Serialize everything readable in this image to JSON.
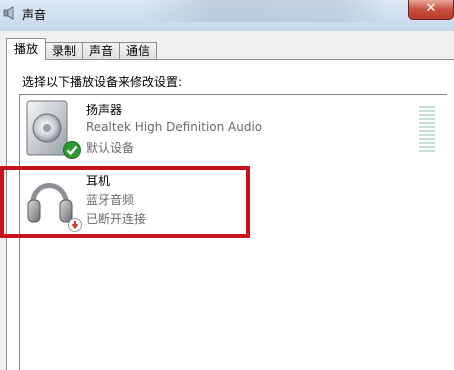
{
  "window": {
    "title": "声音",
    "close_label": "✕"
  },
  "tabs": [
    {
      "label": "播放",
      "active": true
    },
    {
      "label": "录制",
      "active": false
    },
    {
      "label": "声音",
      "active": false
    },
    {
      "label": "通信",
      "active": false
    }
  ],
  "main": {
    "instruction": "选择以下播放设备来修改设置:"
  },
  "devices": [
    {
      "name": "扬声器",
      "description": "Realtek High Definition Audio",
      "status": "默认设备",
      "icon": "speaker-icon",
      "badge": "default-check-icon"
    },
    {
      "name": "耳机",
      "description": "蓝牙音频",
      "status": "已断开连接",
      "icon": "headphones-icon",
      "badge": "disconnected-arrow-icon"
    }
  ],
  "colors": {
    "highlight": "#c8121e",
    "check_green": "#2e9b2e",
    "disconnected_red": "#c0392b"
  }
}
